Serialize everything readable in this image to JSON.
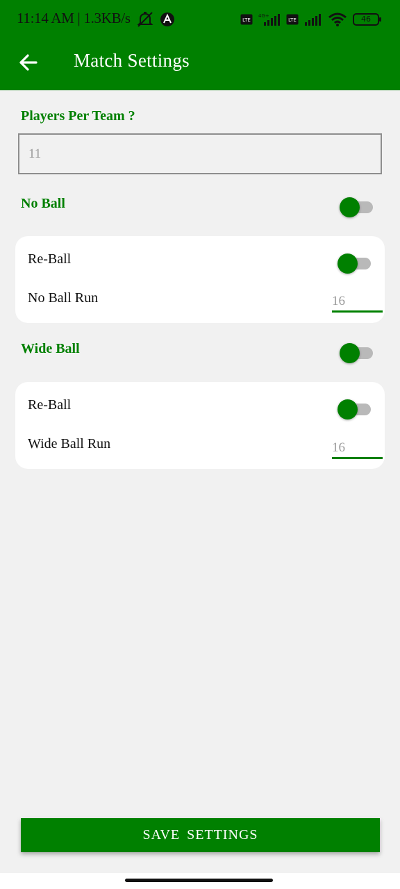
{
  "status_bar": {
    "time": "11:14 AM | 1.3KB/s",
    "battery": "46",
    "icons": [
      "mute-icon",
      "app-notification-icon",
      "volte-icon",
      "4g-signal-icon",
      "volte-icon",
      "signal-icon",
      "wifi-icon",
      "battery-icon"
    ]
  },
  "app_bar": {
    "title": "Match Settings",
    "back_icon": "arrow-left-icon"
  },
  "players": {
    "label": "Players Per Team ?",
    "placeholder": "11"
  },
  "no_ball": {
    "label": "No Ball",
    "enabled": true,
    "reball_label": "Re-Ball",
    "reball_enabled": true,
    "run_label": "No Ball Run",
    "run_placeholder": "16"
  },
  "wide_ball": {
    "label": "Wide Ball",
    "enabled": true,
    "reball_label": "Re-Ball",
    "reball_enabled": true,
    "run_label": "Wide Ball Run",
    "run_placeholder": "16"
  },
  "save_button": {
    "label": "SAVE SETTINGS"
  },
  "colors": {
    "accent": "#008000",
    "background": "#f1f1f1",
    "card": "#ffffff"
  }
}
